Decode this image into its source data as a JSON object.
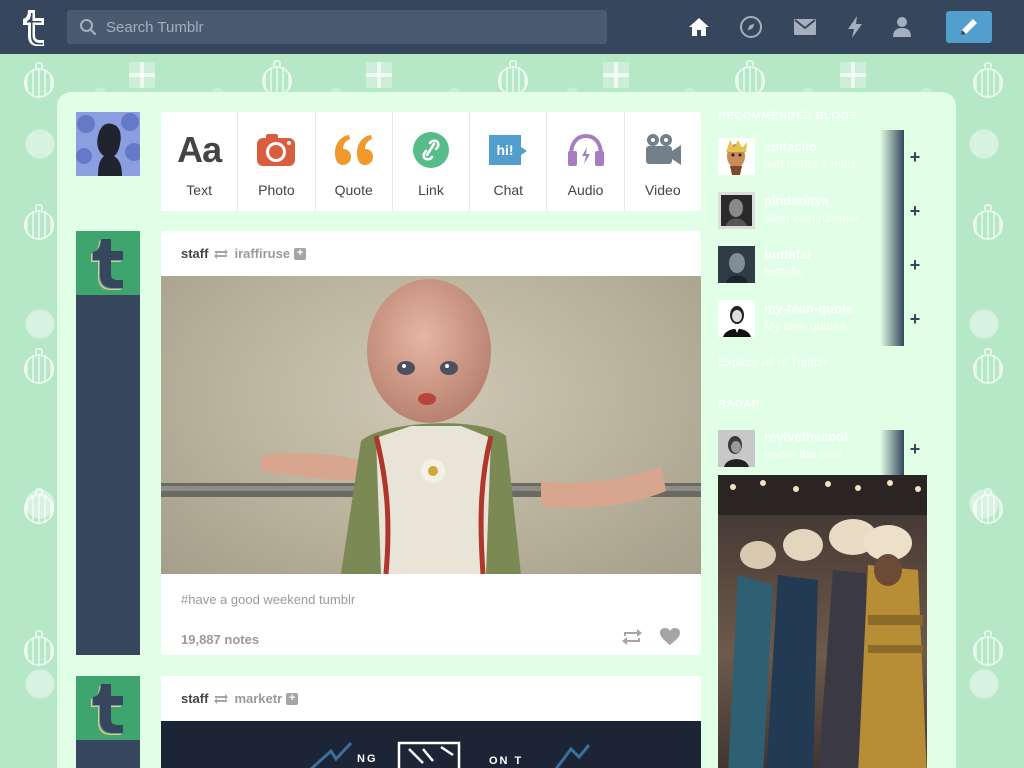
{
  "header": {
    "search_placeholder": "Search Tumblr",
    "nav": [
      "home-icon",
      "explore-icon",
      "inbox-icon",
      "activity-icon",
      "account-icon"
    ],
    "compose": "pencil-icon",
    "color_bg": "#36465d",
    "color_compose": "#529ecc"
  },
  "post_types": [
    {
      "label": "Text",
      "icon": "text-icon"
    },
    {
      "label": "Photo",
      "icon": "camera-icon",
      "color": "#d95e40"
    },
    {
      "label": "Quote",
      "icon": "quote-icon",
      "color": "#f2992e"
    },
    {
      "label": "Link",
      "icon": "link-icon",
      "color": "#56bc8a"
    },
    {
      "label": "Chat",
      "icon": "chat-icon",
      "color": "#529ecc"
    },
    {
      "label": "Audio",
      "icon": "headphones-icon",
      "color": "#a77dc2"
    },
    {
      "label": "Video",
      "icon": "video-camera-icon",
      "color": "#748089"
    }
  ],
  "posts": [
    {
      "blog": "staff",
      "reblogged_from": "iraffiruse",
      "tags": "#have a good weekend tumblr",
      "notes": "19,887 notes"
    },
    {
      "blog": "staff",
      "reblogged_from": "marketr",
      "banner_text_left": "NG",
      "banner_text_right": "ON T"
    }
  ],
  "sidebar": {
    "recommended_heading": "Recommended Blogs",
    "recommended": [
      {
        "name": "epitaciio",
        "desc": "mel ferraz e mais"
      },
      {
        "name": "pindanitya",
        "desc": "allen wan ruhanie"
      },
      {
        "name": "buttafai",
        "desc": "buttafai"
      },
      {
        "name": "my-teen-quote",
        "desc": "My teen quotes"
      }
    ],
    "explore_link": "Explore all of Tumblr",
    "radar_heading": "Radar",
    "radar": {
      "name": "revivethecool",
      "desc": "revive the cool"
    }
  }
}
